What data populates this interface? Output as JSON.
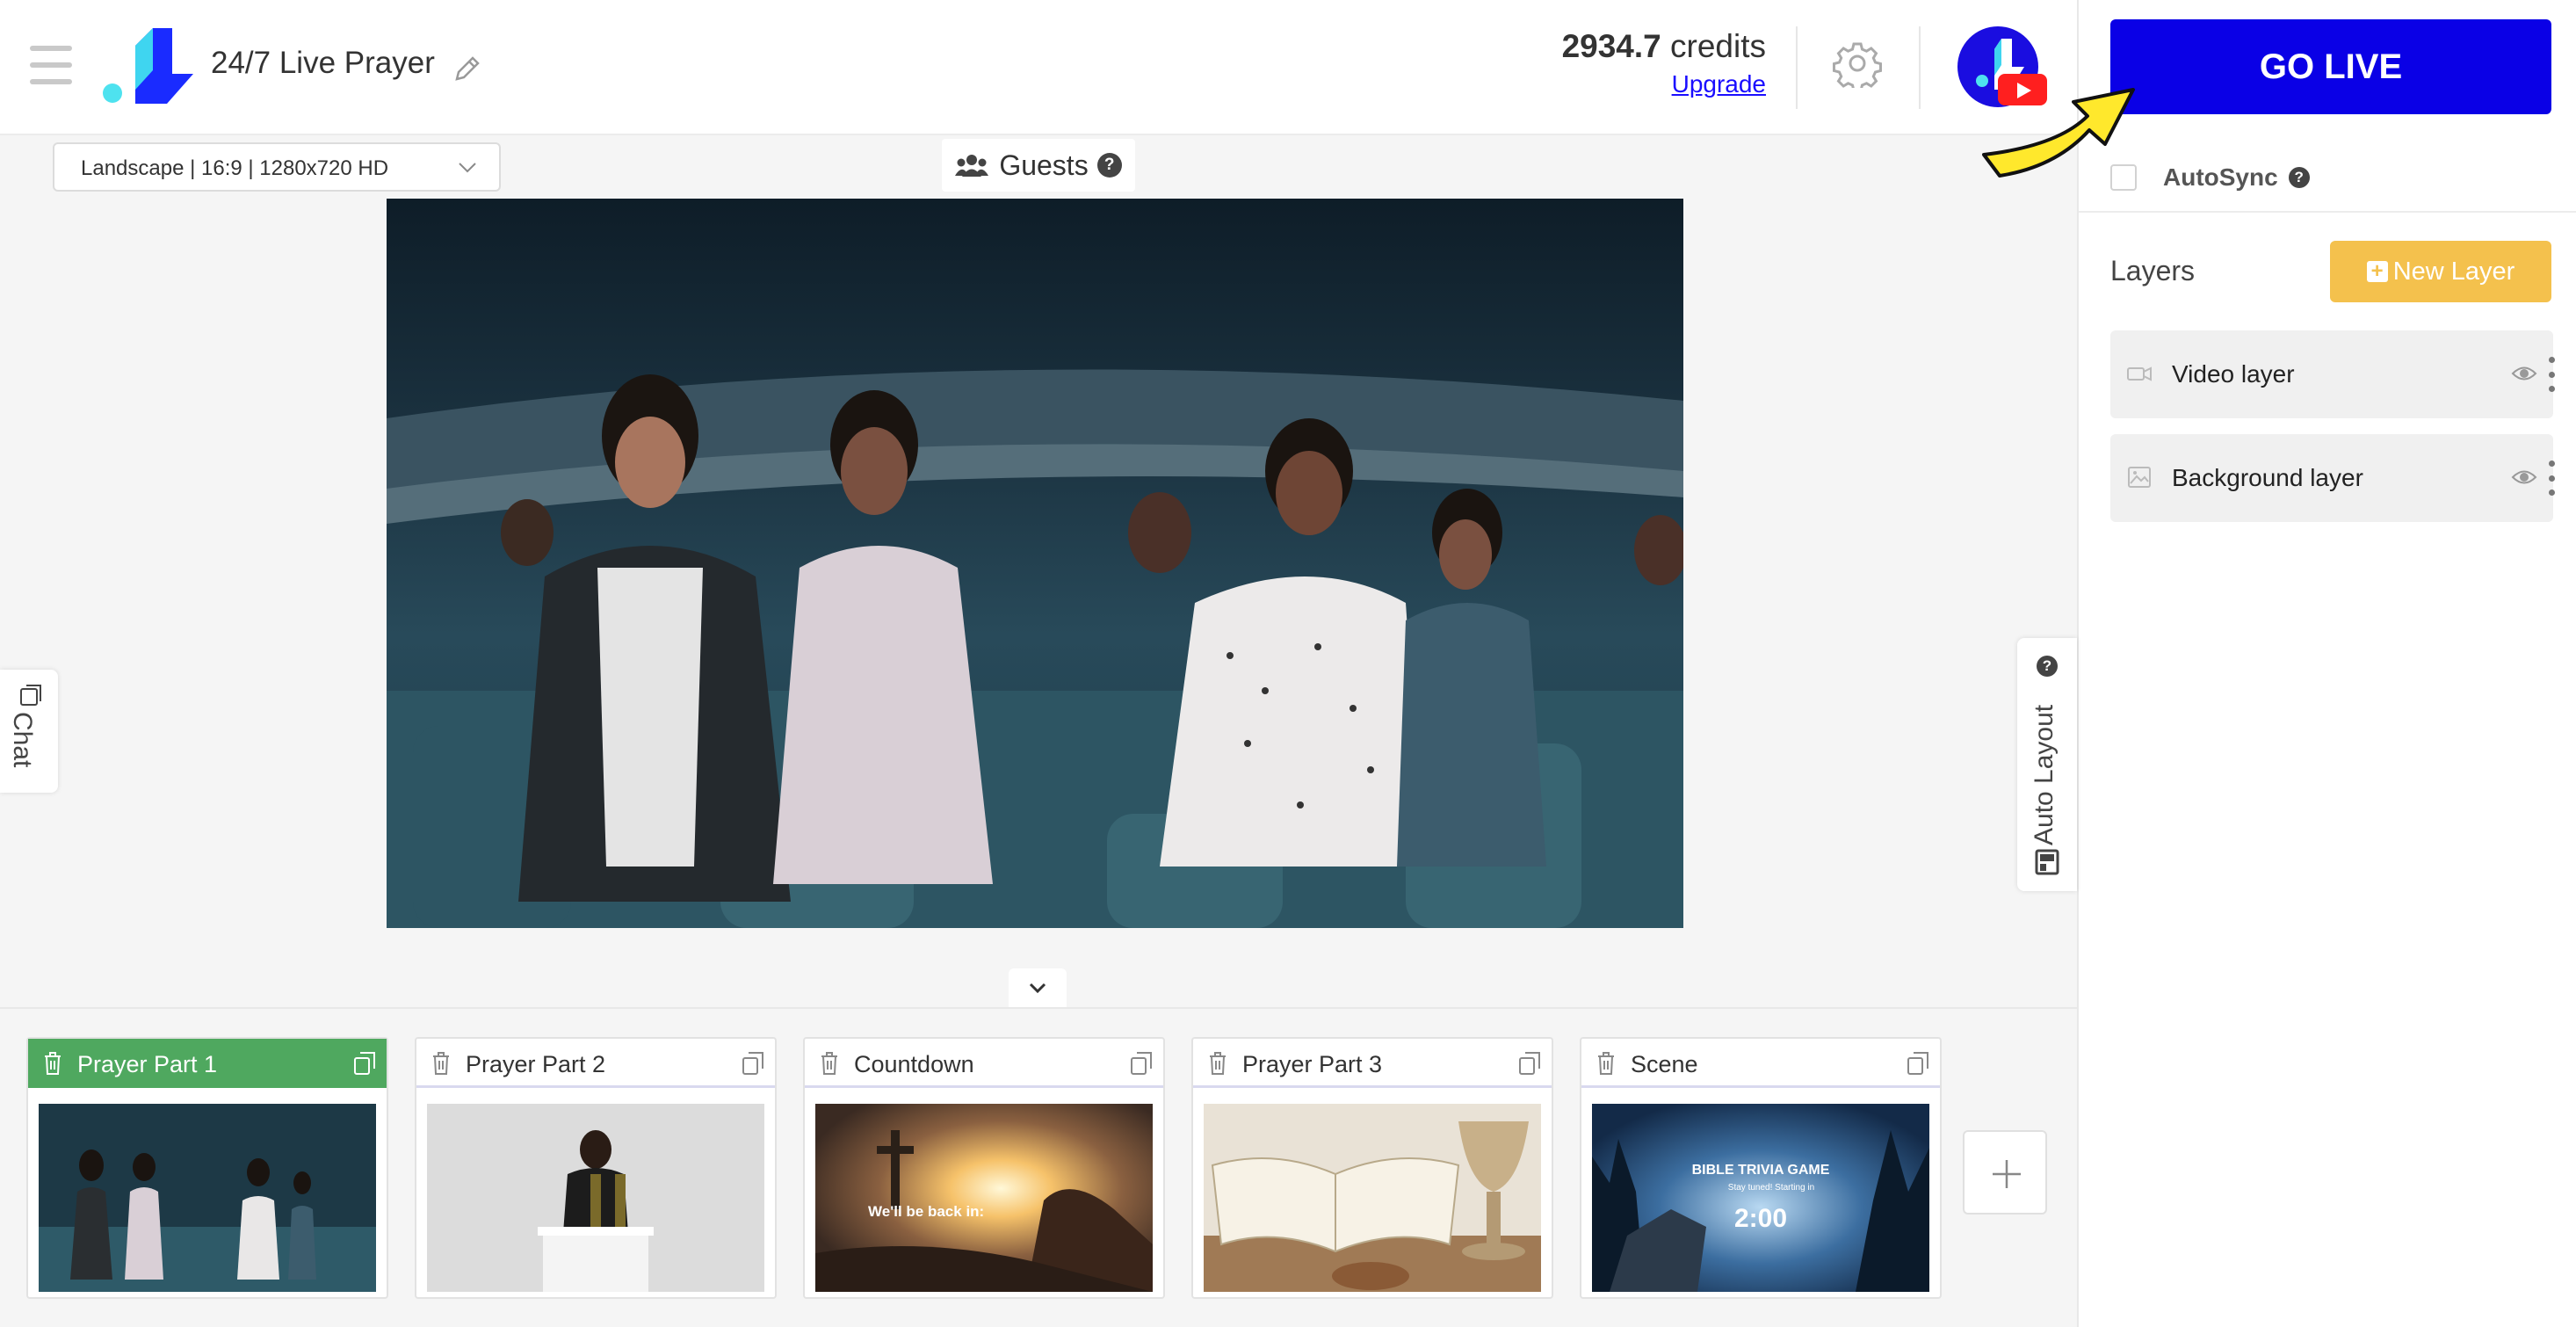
{
  "header": {
    "title": "24/7 Live Prayer",
    "credits_value": "2934.7",
    "credits_unit": "credits",
    "upgrade_label": "Upgrade"
  },
  "toolbar": {
    "resolution": "Landscape | 16:9 | 1280x720 HD",
    "guests_label": "Guests",
    "guests_help": "?"
  },
  "side_tabs": {
    "chat_label": "Chat",
    "auto_layout_label": "Auto Layout"
  },
  "right_panel": {
    "go_live_label": "GO LIVE",
    "autosync_label": "AutoSync",
    "layers_title": "Layers",
    "new_layer_label": "New Layer",
    "layers": [
      {
        "name": "Video layer",
        "icon": "video-camera-icon"
      },
      {
        "name": "Background layer",
        "icon": "image-icon"
      }
    ]
  },
  "scenes": [
    {
      "name": "Prayer Part 1",
      "active": true
    },
    {
      "name": "Prayer Part 2",
      "active": false
    },
    {
      "name": "Countdown",
      "active": false,
      "thumb_text": "We'll be back in:"
    },
    {
      "name": "Prayer Part 3",
      "active": false
    },
    {
      "name": "Scene",
      "active": false,
      "thumb_title": "BIBLE TRIVIA GAME",
      "thumb_sub": "Stay tuned! Starting in",
      "thumb_time": "2:00"
    }
  ],
  "colors": {
    "go_live": "#0a00e6",
    "new_layer": "#f4c14d",
    "active_scene": "#4fa85f",
    "arrow": "#ffe82c"
  }
}
